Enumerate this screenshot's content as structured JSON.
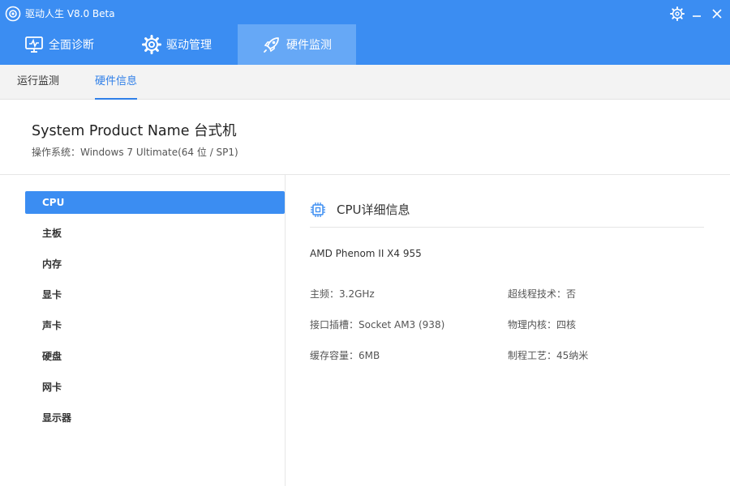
{
  "app": {
    "title": "驱动人生 V8.0 Beta"
  },
  "window": {
    "settings_icon": "gear-icon",
    "minimize_icon": "minimize-icon",
    "close_icon": "close-icon"
  },
  "main_tabs": [
    {
      "label": "全面诊断",
      "icon": "monitor-check-icon"
    },
    {
      "label": "驱动管理",
      "icon": "gear-icon"
    },
    {
      "label": "硬件监测",
      "icon": "rocket-icon",
      "active": true
    }
  ],
  "sub_tabs": [
    {
      "label": "运行监测"
    },
    {
      "label": "硬件信息",
      "active": true
    }
  ],
  "system": {
    "title": "System Product Name 台式机",
    "os_line": "操作系统：Windows 7 Ultimate(64 位 / SP1)"
  },
  "categories": [
    {
      "label": "CPU",
      "active": true
    },
    {
      "label": "主板"
    },
    {
      "label": "内存"
    },
    {
      "label": "显卡"
    },
    {
      "label": "声卡"
    },
    {
      "label": "硬盘"
    },
    {
      "label": "网卡"
    },
    {
      "label": "显示器"
    }
  ],
  "detail": {
    "title": "CPU详细信息",
    "icon": "chip-icon",
    "model": "AMD Phenom II X4 955",
    "specs": [
      "主频：3.2GHz",
      "超线程技术：否",
      "接口插槽：Socket AM3 (938)",
      "物理内核：四核",
      "缓存容量：6MB",
      "制程工艺：45纳米"
    ]
  },
  "colors": {
    "accent": "#3b8df2",
    "active_tab_bg": "#66a8f6",
    "subnav_bg": "#f3f3f3",
    "link_blue": "#2f7fe8"
  }
}
